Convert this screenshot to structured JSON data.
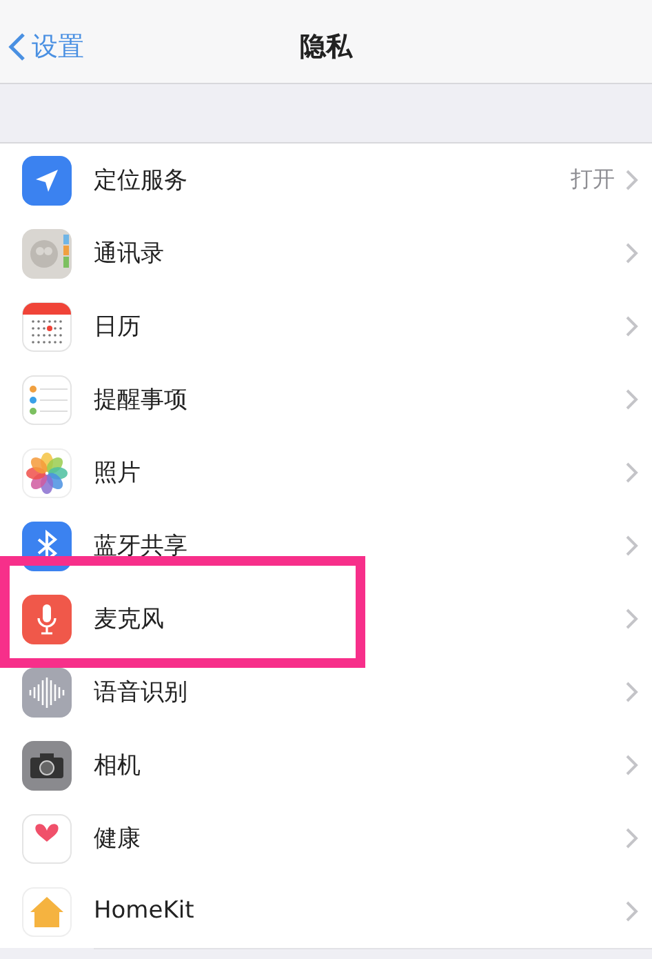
{
  "nav_bar": {
    "back_label": "设置",
    "title": "隐私"
  },
  "rows": [
    {
      "kind": "location",
      "label": "定位服务",
      "value": "打开",
      "highlighted": false
    },
    {
      "kind": "contacts",
      "label": "通讯录",
      "highlighted": false
    },
    {
      "kind": "calendar",
      "label": "日历",
      "highlighted": false
    },
    {
      "kind": "reminders",
      "label": "提醒事项",
      "highlighted": false
    },
    {
      "kind": "photos",
      "label": "照片",
      "highlighted": false
    },
    {
      "kind": "bluetooth",
      "label": "蓝牙共享",
      "highlighted": false
    },
    {
      "kind": "microphone",
      "label": "麦克风",
      "highlighted": true
    },
    {
      "kind": "speech",
      "label": "语音识别",
      "highlighted": false
    },
    {
      "kind": "camera",
      "label": "相机",
      "highlighted": false
    },
    {
      "kind": "health",
      "label": "健康",
      "highlighted": false
    },
    {
      "kind": "homekit",
      "label": "HomeKit",
      "highlighted": false
    }
  ]
}
